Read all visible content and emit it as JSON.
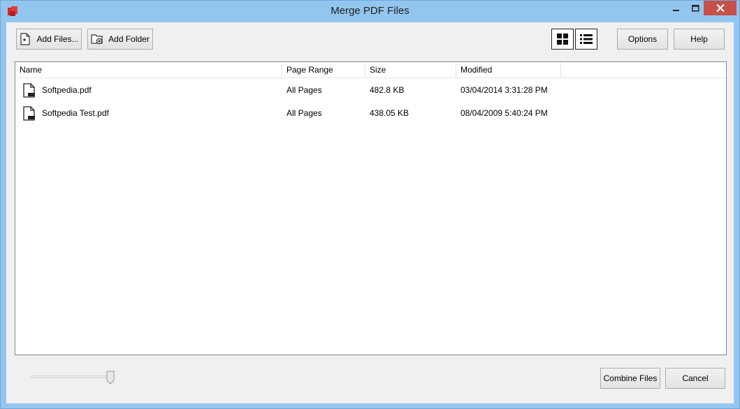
{
  "window": {
    "title": "Merge PDF Files",
    "accent": "#93c6ef",
    "close_color": "#c7504a",
    "controls": {
      "minimize_icon": "minimize-icon",
      "maximize_icon": "maximize-icon",
      "close_icon": "close-icon"
    }
  },
  "toolbar": {
    "add_files_label": "Add Files...",
    "add_folder_label": "Add Folder",
    "options_label": "Options",
    "help_label": "Help",
    "view_modes": [
      "grid-view-icon",
      "list-view-icon"
    ],
    "active_view": "list"
  },
  "table": {
    "columns": [
      "Name",
      "Page Range",
      "Size",
      "Modified"
    ],
    "rows": [
      {
        "name": "Softpedia.pdf",
        "page_range": "All Pages",
        "size": "482.8 KB",
        "modified": "03/04/2014 3:31:28 PM"
      },
      {
        "name": "Softpedia Test.pdf",
        "page_range": "All Pages",
        "size": "438.05 KB",
        "modified": "08/04/2009 5:40:24 PM"
      }
    ]
  },
  "footer": {
    "zoom_slider_level": 1.0,
    "combine_label": "Combine Files",
    "cancel_label": "Cancel"
  }
}
